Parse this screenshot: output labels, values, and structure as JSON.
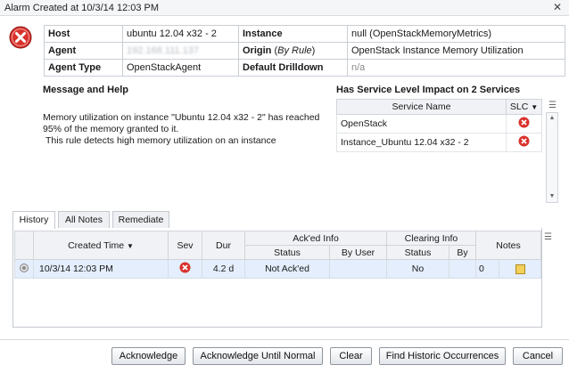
{
  "window": {
    "title": "Alarm Created at 10/3/14 12:03 PM"
  },
  "props": {
    "host_label": "Host",
    "host_value": "ubuntu 12.04 x32 - 2",
    "instance_label": "Instance",
    "instance_value": "null (OpenStackMemoryMetrics)",
    "agent_label": "Agent",
    "agent_value": "192.168.111.137",
    "origin_label": "Origin",
    "origin_paren_open": " (",
    "origin_by": "By Rule",
    "origin_paren_close": ")",
    "origin_value": "OpenStack Instance Memory Utilization",
    "agent_type_label": "Agent Type",
    "agent_type_value": "OpenStackAgent",
    "drilldown_label": "Default Drilldown",
    "drilldown_value": "n/a"
  },
  "message": {
    "title": "Message and Help",
    "line1": "Memory utilization on instance \"Ubuntu 12.04 x32 - 2\" has reached 95% of the memory granted to it.",
    "line2": "This rule detects high memory utilization on an instance"
  },
  "service_impact": {
    "title": "Has Service Level Impact on 2 Services",
    "col_name": "Service Name",
    "col_slc": "SLC",
    "rows": [
      {
        "name": "OpenStack"
      },
      {
        "name": "Instance_Ubuntu 12.04 x32 - 2"
      }
    ]
  },
  "tabs": [
    "History",
    "All Notes",
    "Remediate"
  ],
  "history": {
    "col_created": "Created Time",
    "col_sev": "Sev",
    "col_dur": "Dur",
    "group_acked": "Ack'ed Info",
    "group_clearing": "Clearing Info",
    "col_notes": "Notes",
    "sub_status": "Status",
    "sub_by_user": "By User",
    "sub_status2": "Status",
    "sub_by": "By",
    "rows": [
      {
        "created": "10/3/14 12:03 PM",
        "dur": "4.2 d",
        "ack_status": "Not Ack'ed",
        "ack_by": "",
        "clear_status": "No",
        "clear_by": "",
        "notes": "0"
      }
    ]
  },
  "buttons": {
    "acknowledge": "Acknowledge",
    "ack_until_normal": "Acknowledge Until Normal",
    "clear": "Clear",
    "find_historic": "Find Historic Occurrences",
    "cancel": "Cancel"
  },
  "colors": {
    "alarm_red": "#d9322c",
    "selection": "#e4eefc"
  },
  "icons": {
    "alarm": "alarm-x-icon",
    "close": "close-icon",
    "sort": "sort-down-icon",
    "note": "note-icon"
  }
}
